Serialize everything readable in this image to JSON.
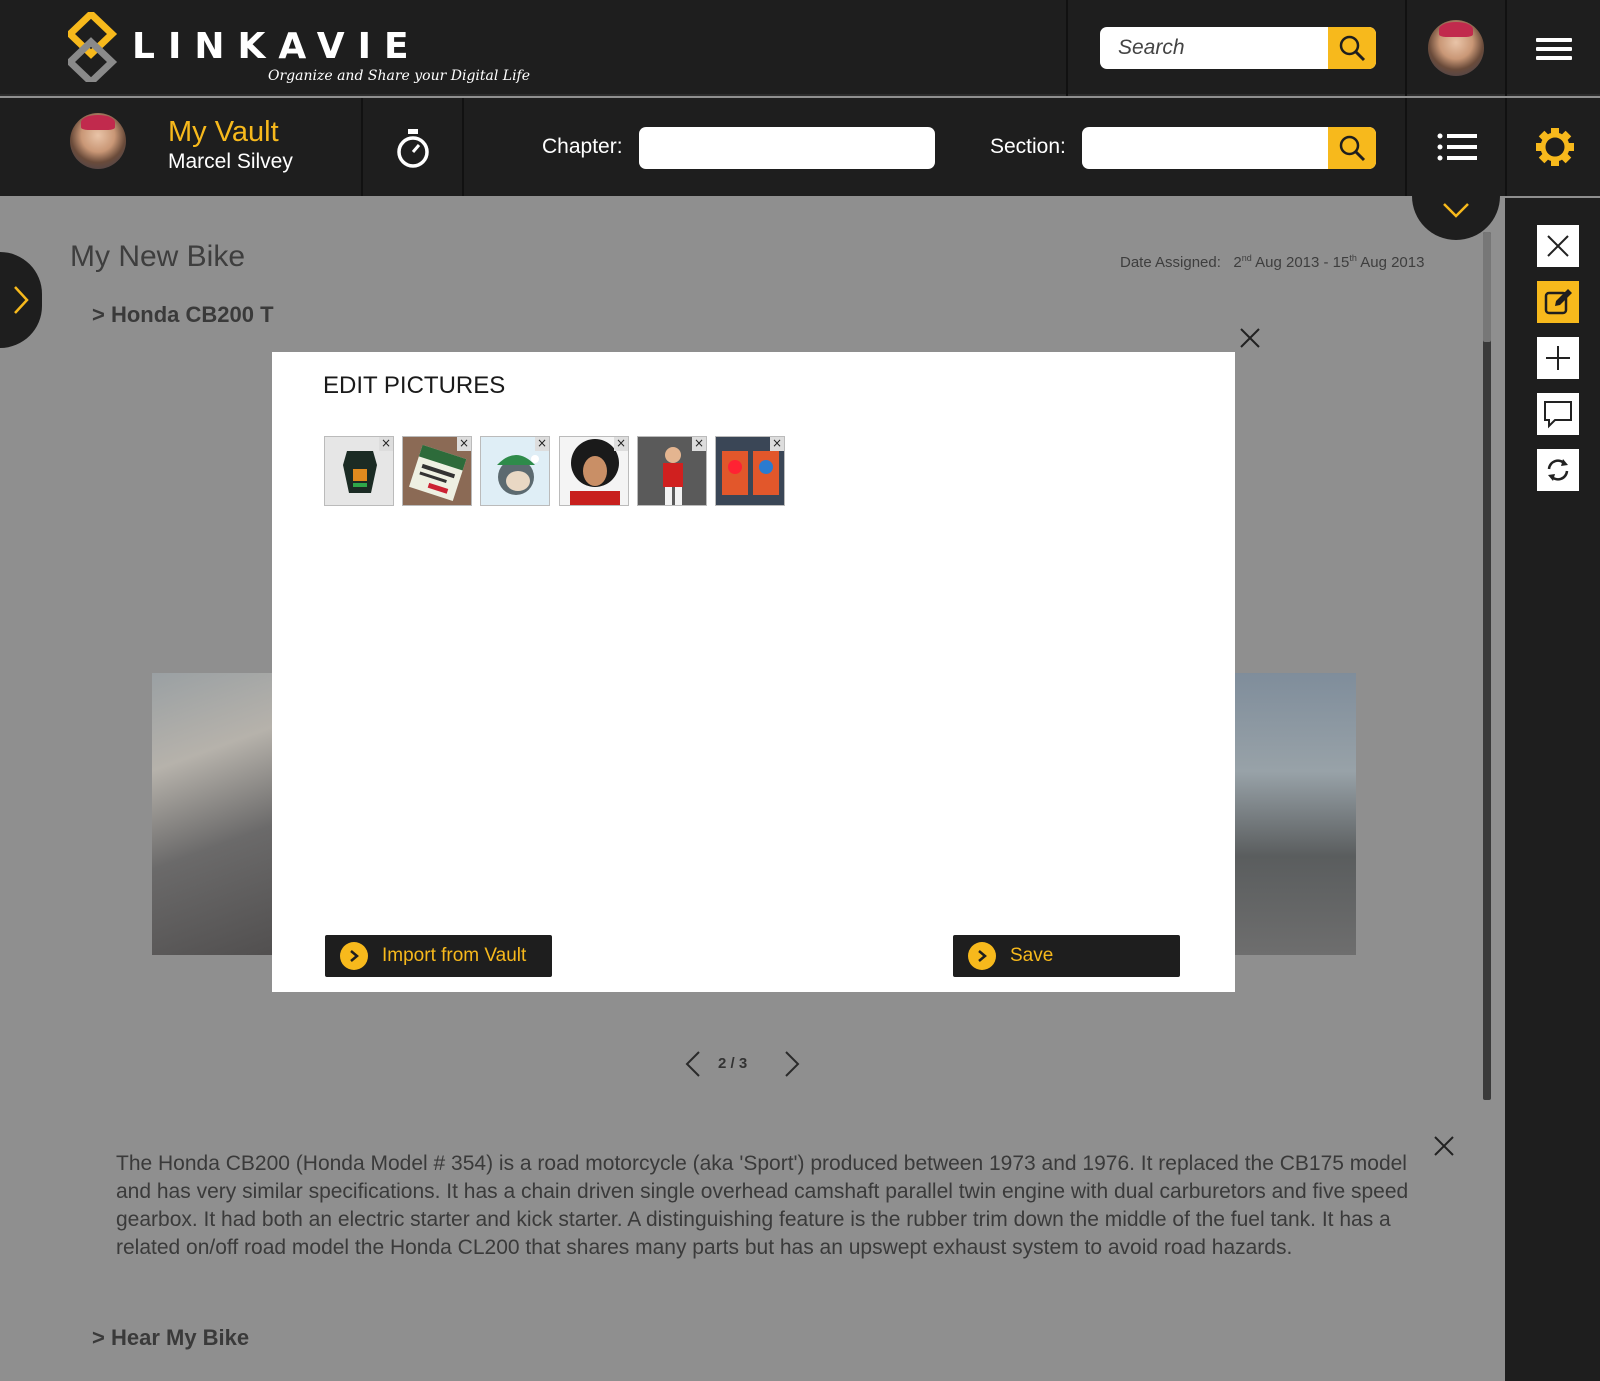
{
  "brand": {
    "name": "LINKAVIE",
    "tagline": "Organize and Share your Digital Life"
  },
  "header": {
    "search_placeholder": "Search"
  },
  "vault": {
    "title": "My Vault",
    "user": "Marcel Silvey"
  },
  "filters": {
    "chapter_label": "Chapter:",
    "section_label": "Section:"
  },
  "colors": {
    "accent": "#f7b91c",
    "bar": "#1e1e1e",
    "overlay": "#8f8f8f"
  },
  "page": {
    "title": "My New Bike",
    "date_label": "Date Assigned:",
    "date_start_day": "2",
    "date_start_sup": "nd",
    "date_start_rest": " Aug 2013 - 15",
    "date_end_sup": "th",
    "date_end_rest": " Aug 2013",
    "crumb": "> Honda CB200 T",
    "pager": "2 / 3",
    "description": "The Honda CB200 (Honda Model # 354) is a road motorcycle (aka 'Sport') produced between 1973 and 1976. It replaced the CB175 model and has very similar specifications. It has a chain driven single overhead camshaft parallel twin engine with dual carburetors and five speed gearbox. It had both an electric starter and kick starter. A distinguishing feature is the rubber trim down the middle of the fuel tank. It has a related on/off road model the Honda CL200 that shares many parts but has an upswept exhaust system to avoid road hazards.",
    "crumb2": "> Hear My Bike"
  },
  "modal": {
    "title": "EDIT PICTURES",
    "import_label": "Import from Vault",
    "save_label": "Save",
    "delete_glyph": "×",
    "thumbnails": [
      "battery-image",
      "miles-sign-image",
      "monkey-image",
      "curly-hair-man-image",
      "soccer-player-image",
      "app-screens-image"
    ]
  },
  "toolbar_icons": [
    "close-icon",
    "edit-icon",
    "plus-icon",
    "comment-icon",
    "refresh-icon"
  ]
}
